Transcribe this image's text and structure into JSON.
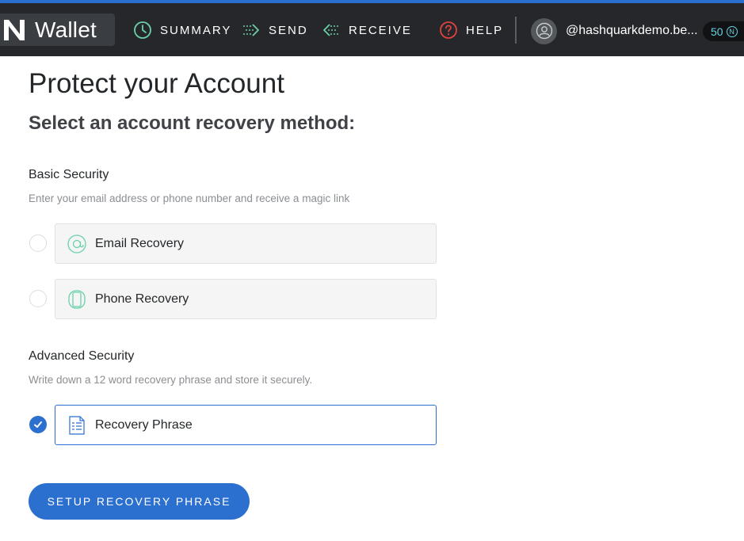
{
  "app": {
    "logo_text": "Wallet"
  },
  "nav": {
    "summary": "SUMMARY",
    "send": "SEND",
    "receive": "RECEIVE",
    "help": "HELP"
  },
  "account": {
    "name": "@hashquarkdemo.be...",
    "balance": "50",
    "balance_symbol": "N"
  },
  "page": {
    "title": "Protect your Account",
    "subtitle": "Select an account recovery method:"
  },
  "basic": {
    "heading": "Basic Security",
    "description": "Enter your email address or phone number and receive a magic link",
    "options": [
      {
        "label": "Email Recovery",
        "icon": "at-icon",
        "selected": false
      },
      {
        "label": "Phone Recovery",
        "icon": "phone-icon",
        "selected": false
      }
    ]
  },
  "advanced": {
    "heading": "Advanced Security",
    "description": "Write down a 12 word recovery phrase and store it securely.",
    "options": [
      {
        "label": "Recovery Phrase",
        "icon": "document-icon",
        "selected": true
      }
    ]
  },
  "cta": {
    "label": "SETUP RECOVERY PHRASE"
  },
  "colors": {
    "accent": "#2b6fcf",
    "navbar": "#25272a",
    "icon_green": "#6ad1a8",
    "balance_text": "#6ad1e3"
  }
}
